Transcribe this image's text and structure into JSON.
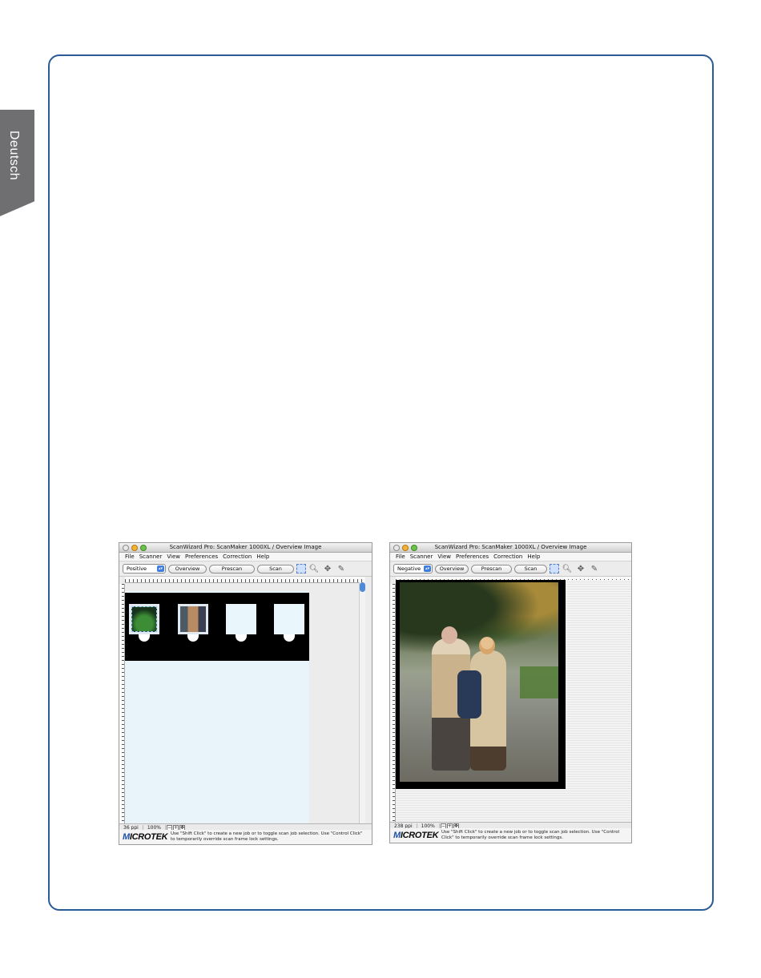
{
  "side_tab": {
    "label": "Deutsch"
  },
  "windows": [
    {
      "title": "ScanWizard Pro: ScanMaker 1000XL / Overview Image",
      "menu": [
        "File",
        "Scanner",
        "View",
        "Preferences",
        "Correction",
        "Help"
      ],
      "mode": "Positive",
      "buttons": {
        "overview": "Overview",
        "prescan": "Prescan",
        "scan": "Scan"
      },
      "status": {
        "resolution": "36 ppi",
        "zoom": "100%"
      },
      "logo": "MICROTEK",
      "hint": "Use \"Shift Click\" to create a new job or to toggle scan job selection. Use \"Control Click\" to temporarily override scan frame lock settings."
    },
    {
      "title": "ScanWizard Pro: ScanMaker 1000XL / Overview Image",
      "menu": [
        "File",
        "Scanner",
        "View",
        "Preferences",
        "Correction",
        "Help"
      ],
      "mode": "Negative",
      "buttons": {
        "overview": "Overview",
        "prescan": "Prescan",
        "scan": "Scan"
      },
      "status": {
        "resolution": "238 ppi",
        "zoom": "100%"
      },
      "logo": "MICROTEK",
      "hint": "Use \"Shift Click\" to create a new job or to toggle scan job selection. Use \"Control Click\" to temporarily override scan frame lock settings."
    }
  ],
  "icons": {
    "marquee": "marquee-icon",
    "zoom": "magnifier-icon",
    "move": "move-icon",
    "eyedropper": "eyedropper-icon"
  },
  "colors": {
    "frame_border": "#2a5b96",
    "tab_bg": "#6f6f72",
    "accent_blue": "#3d7de0"
  }
}
